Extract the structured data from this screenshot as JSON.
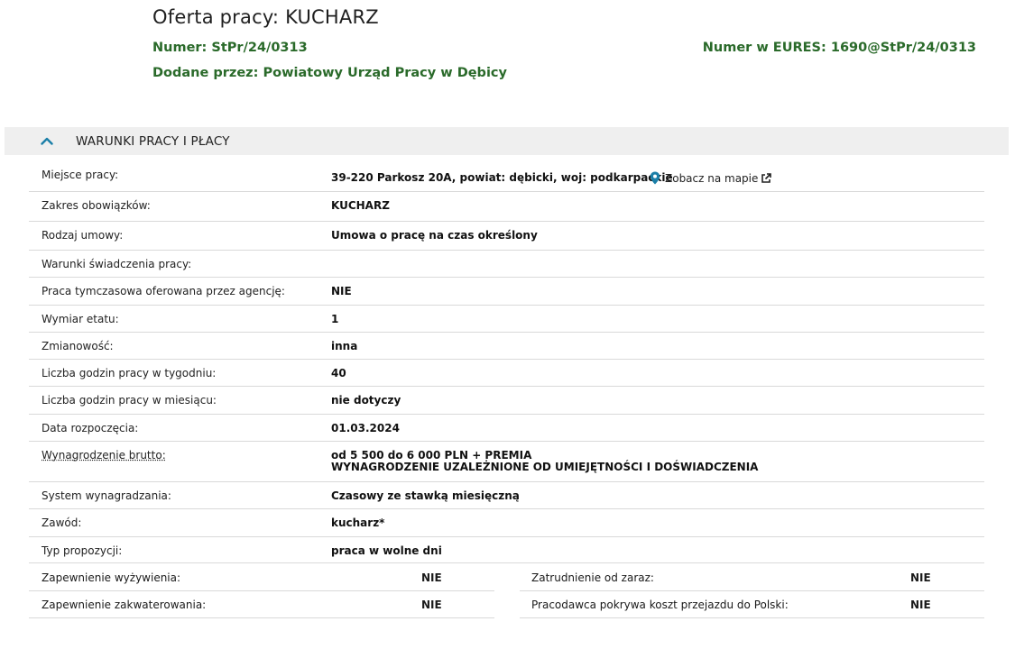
{
  "header": {
    "title": "Oferta pracy: KUCHARZ",
    "number_label": "Numer:",
    "number_value": "StPr/24/0313",
    "eures_label": "Numer w EURES:",
    "eures_value": "1690@StPr/24/0313",
    "added_label": "Dodane przez:",
    "added_value": "Powiatowy Urząd Pracy w Dębicy"
  },
  "section": {
    "title": "WARUNKI PRACY I PŁACY",
    "icon": "chevron-up-icon",
    "accent": "#1b7fa8"
  },
  "location": {
    "label": "Miejsce pracy:",
    "value": "39-220 Parkosz 20A, powiat: dębicki, woj: podkarpackie",
    "map_link": "Zobacz na mapie"
  },
  "rows": [
    {
      "label": "Zakres obowiązków:",
      "value": "KUCHARZ"
    },
    {
      "label": "Rodzaj umowy:",
      "value": "Umowa o pracę na czas określony"
    },
    {
      "label": "Warunki świadczenia pracy:",
      "value": ""
    },
    {
      "label": "Praca tymczasowa oferowana przez agencję:",
      "value": "NIE"
    },
    {
      "label": "Wymiar etatu:",
      "value": "1"
    },
    {
      "label": "Zmianowość:",
      "value": "inna"
    },
    {
      "label": "Liczba godzin pracy w tygodniu:",
      "value": "40"
    },
    {
      "label": "Liczba godzin pracy w miesiącu:",
      "value": "nie dotyczy"
    },
    {
      "label": "Data rozpoczęcia:",
      "value": "01.03.2024"
    }
  ],
  "salary": {
    "label": "Wynagrodzenie brutto:",
    "line1": "od 5 500 do 6 000 PLN + PREMIA",
    "line2": "WYNAGRODZENIE UZALEŻNIONE OD UMIEJĘTNOŚCI I DOŚWIADCZENIA"
  },
  "rows2": [
    {
      "label": "System wynagradzania:",
      "value": "Czasowy ze stawką miesięczną"
    },
    {
      "label": "Zawód:",
      "value": "kucharz*"
    },
    {
      "label": "Typ propozycji:",
      "value": "praca w wolne dni"
    }
  ],
  "split": [
    {
      "left": {
        "label": "Zapewnienie wyżywienia:",
        "value": "NIE"
      },
      "right": {
        "label": "Zatrudnienie od zaraz:",
        "value": "NIE"
      }
    },
    {
      "left": {
        "label": "Zapewnienie zakwaterowania:",
        "value": "NIE"
      },
      "right": {
        "label": "Pracodawca pokrywa koszt przejazdu do Polski:",
        "value": "NIE"
      }
    }
  ],
  "colors": {
    "green": "#2a6a2a",
    "pin": "#1b7fa8"
  }
}
